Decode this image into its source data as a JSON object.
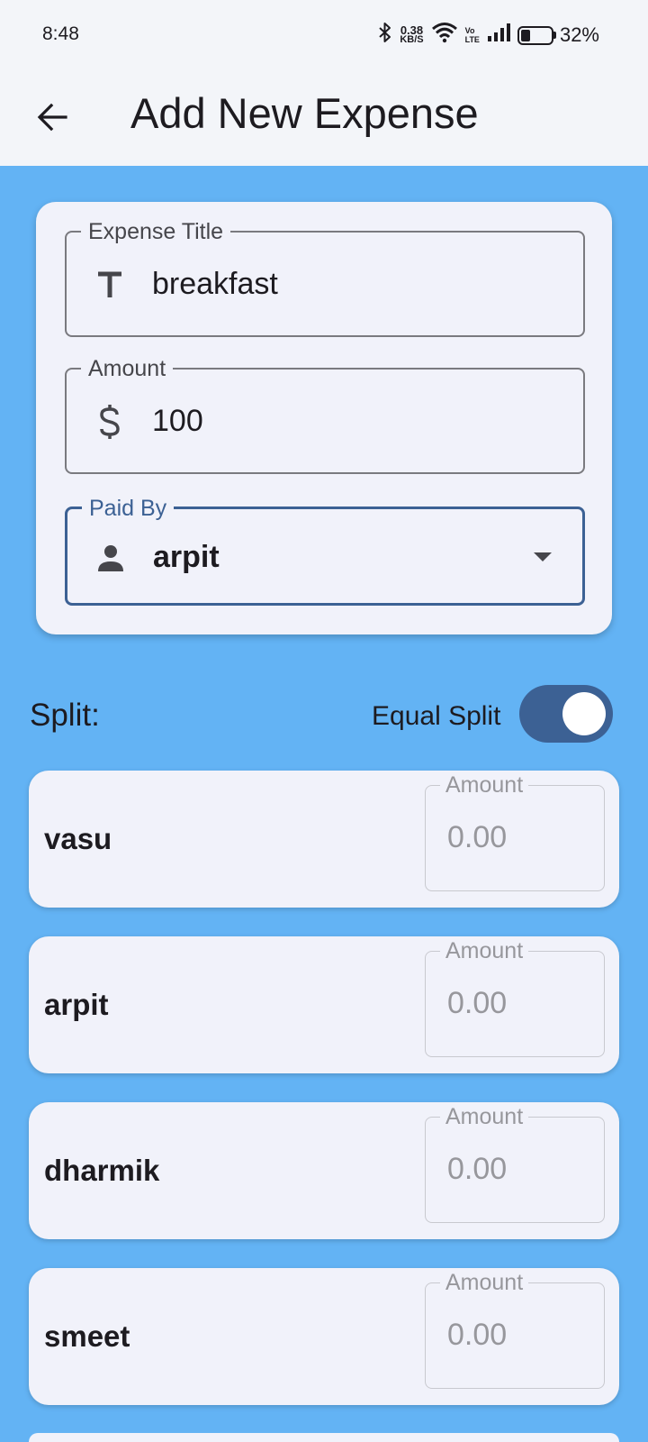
{
  "status_bar": {
    "time": "8:48",
    "net_speed_value": "0.38",
    "net_speed_unit": "KB/S",
    "volte_top": "Vo",
    "volte_bottom": "LTE",
    "battery": "32%",
    "icons": [
      "bluetooth-icon",
      "wifi-icon",
      "signal-icon",
      "battery-icon"
    ]
  },
  "app_bar": {
    "title": "Add New Expense",
    "back_icon": "arrow-left-icon"
  },
  "form": {
    "title_field": {
      "label": "Expense Title",
      "value": "breakfast",
      "icon": "title-t-icon"
    },
    "amount_field": {
      "label": "Amount",
      "value": "100",
      "icon": "dollar-icon"
    },
    "paid_by_field": {
      "label": "Paid By",
      "value": "arpit",
      "icon": "person-icon"
    }
  },
  "split": {
    "label": "Split:",
    "equal_split_label": "Equal Split",
    "equal_split_on": true
  },
  "members": [
    {
      "name": "vasu",
      "amount_label": "Amount",
      "amount_placeholder": "0.00"
    },
    {
      "name": "arpit",
      "amount_label": "Amount",
      "amount_placeholder": "0.00"
    },
    {
      "name": "dharmik",
      "amount_label": "Amount",
      "amount_placeholder": "0.00"
    },
    {
      "name": "smeet",
      "amount_label": "Amount",
      "amount_placeholder": "0.00"
    }
  ],
  "colors": {
    "background": "#63b3f4",
    "surface": "#f1f2fa",
    "primary": "#3c6194",
    "app_bar": "#f3f5f9"
  }
}
